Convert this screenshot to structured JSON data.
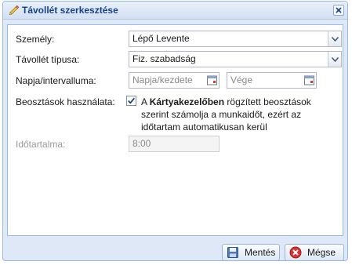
{
  "dialog": {
    "title": "Távollét szerkesztése",
    "title_icon": "pencil-icon",
    "close_icon": "close-icon"
  },
  "form": {
    "person_label": "Személy:",
    "person_value": "Lépő Levente",
    "absence_type_label": "Távollét típusa:",
    "absence_type_value": "Fiz. szabadság",
    "date_label": "Napja/intervalluma:",
    "start_placeholder": "Napja/kezdete",
    "end_placeholder": "Vége",
    "schedule_label": "Beosztások használata:",
    "schedule_checked": true,
    "schedule_text_prefix": "A ",
    "schedule_text_bold": "Kártyakezelőben",
    "schedule_text_suffix": " rögzített beosztások szerint számolja a munkaidőt, ezért az időtartam automatikusan kerül meghatározásra.",
    "duration_label": "Időtartalma:",
    "duration_value": "8:00"
  },
  "buttons": {
    "save_label": "Mentés",
    "save_icon": "floppy-disk-icon",
    "cancel_label": "Mégse",
    "cancel_icon": "cancel-icon"
  },
  "colors": {
    "title_text": "#15428b",
    "frame_border": "#99bbe8",
    "frame_background": "#dfe8f6"
  }
}
